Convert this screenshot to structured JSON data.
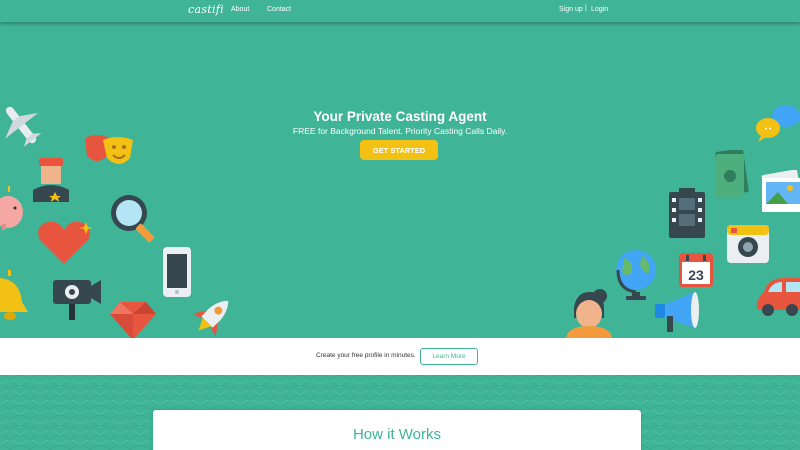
{
  "nav": {
    "logo": "castifi",
    "about": "About",
    "contact": "Contact",
    "signup": "Sign up",
    "separator": "|",
    "login": "Login"
  },
  "hero": {
    "title": "Your Private Casting Agent",
    "subtitle": "FREE for Background Talent. Priority Casting Calls Daily.",
    "cta": "GET STARTED",
    "calendar_day": "23",
    "chat_dots": "• •"
  },
  "strip": {
    "text": "Create your free profile in minutes.",
    "button": "Learn More"
  },
  "section": {
    "title": "How it Works"
  },
  "colors": {
    "brand": "#3fb497",
    "accent": "#f2c114",
    "white": "#ffffff"
  },
  "icons": [
    "airplane-icon",
    "theater-masks-icon",
    "police-officer-icon",
    "piggy-bank-icon",
    "magnifier-icon",
    "heart-icon",
    "smartphone-icon",
    "bell-icon",
    "video-camera-icon",
    "gem-icon",
    "rocket-icon",
    "chat-bubbles-icon",
    "money-icon",
    "film-strip-icon",
    "photos-icon",
    "camera-icon",
    "globe-icon",
    "calendar-icon",
    "megaphone-icon",
    "girl-avatar-icon",
    "car-icon"
  ]
}
